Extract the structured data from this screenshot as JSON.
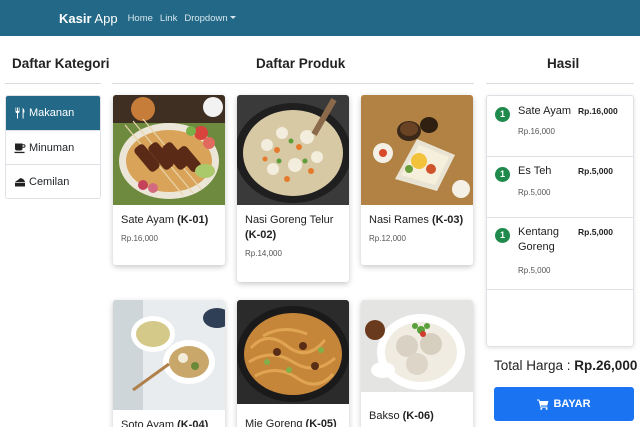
{
  "navbar": {
    "brand_bold": "Kasir",
    "brand_rest": " App",
    "links": [
      "Home",
      "Link",
      "Dropdown"
    ]
  },
  "categories": {
    "title": "Daftar Kategori",
    "items": [
      {
        "label": "Makanan",
        "icon": "utensils-icon",
        "active": true
      },
      {
        "label": "Minuman",
        "icon": "coffee-icon",
        "active": false
      },
      {
        "label": "Cemilan",
        "icon": "cheese-icon",
        "active": false
      }
    ]
  },
  "products": {
    "title": "Daftar Produk",
    "items": [
      {
        "name": "Sate Ayam",
        "code": "(K-01)",
        "price": "Rp.16,000"
      },
      {
        "name": "Nasi Goreng Telur",
        "code": "(K-02)",
        "price": "Rp.14,000"
      },
      {
        "name": "Nasi Rames",
        "code": "(K-03)",
        "price": "Rp.12,000"
      },
      {
        "name": "Soto Ayam",
        "code": "(K-04)",
        "price": ""
      },
      {
        "name": "Mie Goreng",
        "code": "(K-05)",
        "price": ""
      },
      {
        "name": "Bakso",
        "code": "(K-06)",
        "price": ""
      }
    ]
  },
  "result": {
    "title": "Hasil",
    "items": [
      {
        "qty": "1",
        "name": "Sate Ayam",
        "unit_price": "Rp.16,000",
        "total": "Rp.16,000"
      },
      {
        "qty": "1",
        "name": "Es Teh",
        "unit_price": "Rp.5,000",
        "total": "Rp.5,000"
      },
      {
        "qty": "1",
        "name": "Kentang Goreng",
        "unit_price": "Rp.5,000",
        "total": "Rp.5,000"
      }
    ],
    "total_label": "Total Harga : ",
    "total_value": "Rp.26,000",
    "pay_label": "BAYAR"
  },
  "colors": {
    "navbar": "#236987",
    "active_category": "#236987",
    "badge": "#1f8a4c",
    "pay_button": "#1a73f0"
  }
}
